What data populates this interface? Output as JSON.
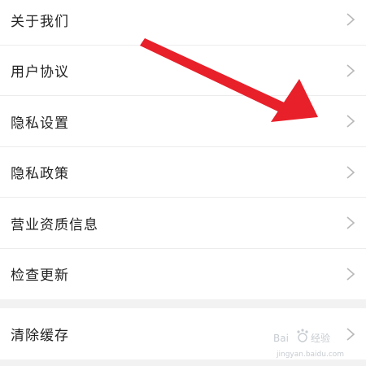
{
  "menu_group_1": [
    {
      "label": "关于我们"
    },
    {
      "label": "用户协议"
    },
    {
      "label": "隐私设置"
    },
    {
      "label": "隐私政策"
    },
    {
      "label": "营业资质信息"
    },
    {
      "label": "检查更新"
    }
  ],
  "menu_group_2": [
    {
      "label": "清除缓存"
    }
  ],
  "watermark": {
    "brand": "Bai",
    "suffix": "经验",
    "url": "jingyan.baidu.com"
  },
  "colors": {
    "arrow": "#e8202a",
    "chevron": "#b8b8b8",
    "background": "#f2f2f2",
    "row_background": "#ffffff",
    "text": "#222222"
  },
  "icons": {
    "row_trailing": "chevron-right-icon",
    "annotation": "red-arrow-annotation"
  }
}
